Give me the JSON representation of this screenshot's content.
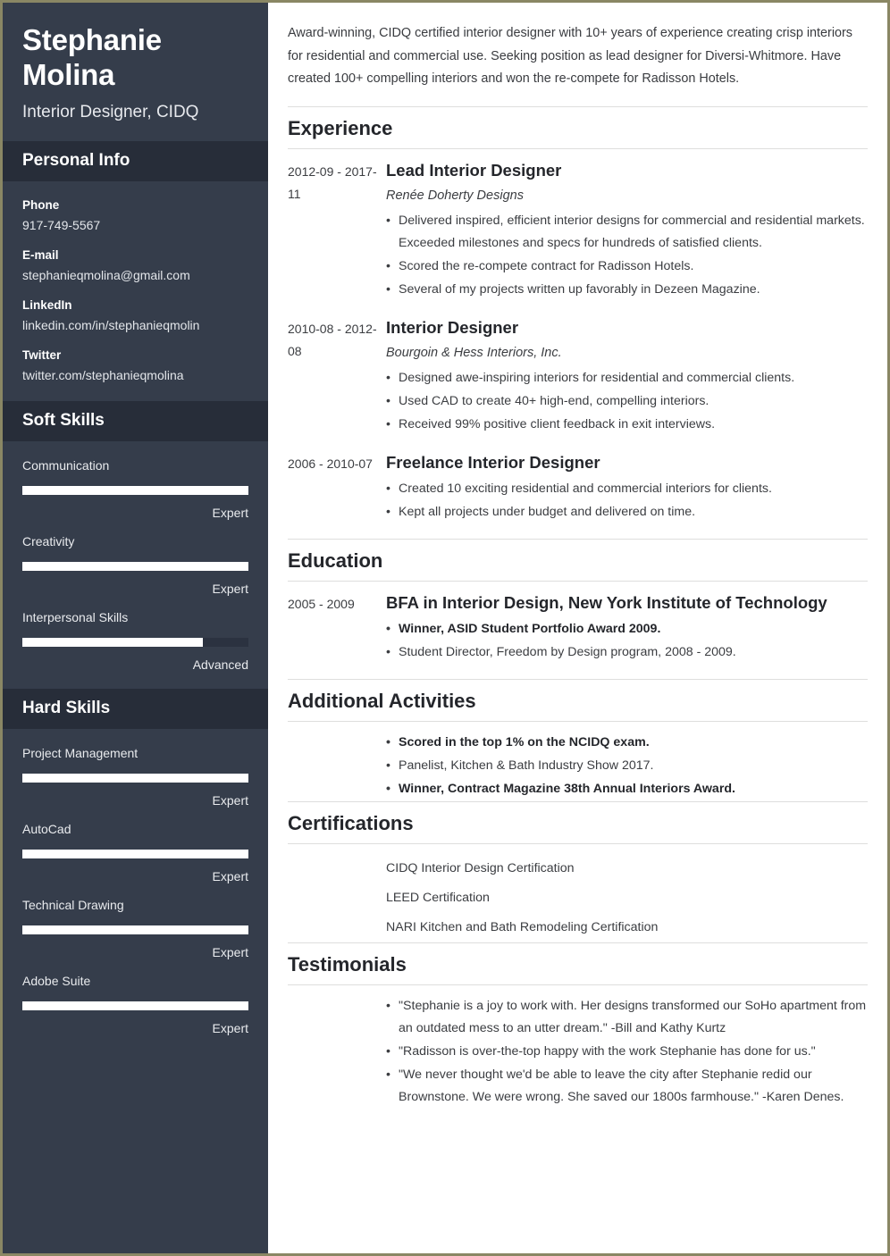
{
  "theme": {
    "page_border": "#8a8764",
    "sidebar_bg": "#353d4b",
    "sidebar_header_bg": "#272d39",
    "bar_track": "#2b3240",
    "bar_fill": "#ffffff",
    "main_text": "#3b3d41",
    "heading_text": "#24262b",
    "rule": "#dededd"
  },
  "sidebar": {
    "full_name": "Stephanie Molina",
    "job_title": "Interior Designer, CIDQ",
    "personal_info": {
      "heading": "Personal Info",
      "items": [
        {
          "label": "Phone",
          "value": "917-749-5567"
        },
        {
          "label": "E-mail",
          "value": "stephanieqmolina@gmail.com"
        },
        {
          "label": "LinkedIn",
          "value": "linkedin.com/in/stephanieqmolin"
        },
        {
          "label": "Twitter",
          "value": "twitter.com/stephanieqmolina"
        }
      ]
    },
    "soft_skills": {
      "heading": "Soft Skills",
      "items": [
        {
          "name": "Communication",
          "level": "Expert",
          "percent": 100
        },
        {
          "name": "Creativity",
          "level": "Expert",
          "percent": 100
        },
        {
          "name": "Interpersonal Skills",
          "level": "Advanced",
          "percent": 80
        }
      ]
    },
    "hard_skills": {
      "heading": "Hard Skills",
      "items": [
        {
          "name": "Project Management",
          "level": "Expert",
          "percent": 100
        },
        {
          "name": "AutoCad",
          "level": "Expert",
          "percent": 100
        },
        {
          "name": "Technical Drawing",
          "level": "Expert",
          "percent": 100
        },
        {
          "name": "Adobe Suite",
          "level": "Expert",
          "percent": 100
        }
      ]
    }
  },
  "main": {
    "summary": "Award-winning, CIDQ certified interior designer with 10+ years of experience creating crisp interiors for residential and commercial use. Seeking position as lead designer for Diversi-Whitmore. Have created 100+ compelling interiors and won the re-compete for Radisson Hotels.",
    "experience": {
      "heading": "Experience",
      "entries": [
        {
          "dates": "2012-09 - 2017-11",
          "title": "Lead Interior Designer",
          "org": "Renée Doherty Designs",
          "bullets": [
            {
              "text": "Delivered inspired, efficient interior designs for commercial and residential markets. Exceeded milestones and specs for hundreds of satisfied clients.",
              "bold": false
            },
            {
              "text": "Scored the re-compete contract for Radisson Hotels.",
              "bold": false
            },
            {
              "text": "Several of my projects written up favorably in Dezeen Magazine.",
              "bold": false
            }
          ]
        },
        {
          "dates": "2010-08 - 2012-08",
          "title": "Interior Designer",
          "org": "Bourgoin & Hess Interiors, Inc.",
          "bullets": [
            {
              "text": "Designed awe-inspiring interiors for residential and commercial clients.",
              "bold": false
            },
            {
              "text": "Used CAD to create 40+ high-end, compelling interiors.",
              "bold": false
            },
            {
              "text": "Received 99% positive client feedback in exit interviews.",
              "bold": false
            }
          ]
        },
        {
          "dates": "2006 - 2010-07",
          "title": "Freelance Interior Designer",
          "org": "",
          "bullets": [
            {
              "text": "Created 10 exciting residential and commercial interiors for clients.",
              "bold": false
            },
            {
              "text": "Kept all projects under budget and delivered on time.",
              "bold": false
            }
          ]
        }
      ]
    },
    "education": {
      "heading": "Education",
      "entries": [
        {
          "dates": "2005 - 2009",
          "title": "BFA in Interior Design, New York Institute of Technology",
          "org": "",
          "bullets": [
            {
              "text": "Winner, ASID Student Portfolio Award 2009.",
              "bold": true
            },
            {
              "text": "Student Director, Freedom by Design program, 2008 - 2009.",
              "bold": false
            }
          ]
        }
      ]
    },
    "additional_activities": {
      "heading": "Additional Activities",
      "bullets": [
        {
          "text": "Scored in the top 1% on the NCIDQ exam.",
          "bold": true
        },
        {
          "text": "Panelist, Kitchen & Bath Industry Show 2017.",
          "bold": false
        },
        {
          "text": "Winner, Contract Magazine 38th Annual Interiors Award.",
          "bold": true
        }
      ]
    },
    "certifications": {
      "heading": "Certifications",
      "items": [
        "CIDQ Interior Design Certification",
        "LEED Certification",
        "NARI Kitchen and Bath Remodeling Certification"
      ]
    },
    "testimonials": {
      "heading": "Testimonials",
      "bullets": [
        {
          "text": "\"Stephanie is a joy to work with. Her designs transformed our SoHo apartment from an outdated mess to an utter dream.\" -Bill and Kathy Kurtz",
          "bold": false
        },
        {
          "text": "\"Radisson is over-the-top happy with the work Stephanie has done for us.\"",
          "bold": false
        },
        {
          "text": "\"We never thought we'd be able to leave the city after Stephanie redid our Brownstone. We were wrong. She saved our 1800s farmhouse.\" -Karen Denes.",
          "bold": false
        }
      ]
    }
  }
}
